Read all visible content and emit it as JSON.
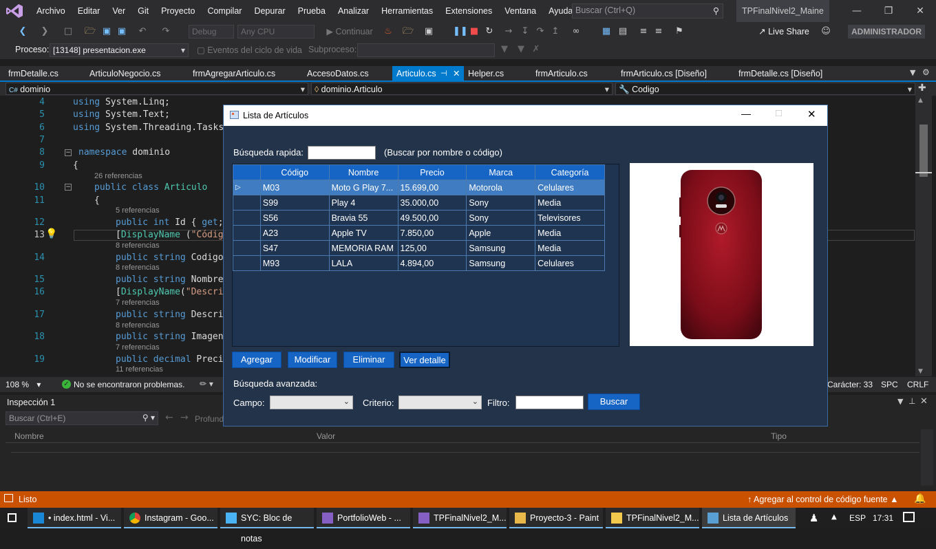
{
  "vs": {
    "menu": [
      "Archivo",
      "Editar",
      "Ver",
      "Git",
      "Proyecto",
      "Compilar",
      "Depurar",
      "Prueba",
      "Analizar",
      "Herramientas",
      "Extensiones",
      "Ventana",
      "Ayuda"
    ],
    "search_placeholder": "Buscar (Ctrl+Q)",
    "solution_title": "TPFinalNivel2_Maine",
    "toolbar": {
      "config": "Debug",
      "platform": "Any CPU",
      "continue": "Continuar",
      "live_share": "Live Share",
      "admin": "ADMINISTRADOR"
    },
    "toolbar2": {
      "process_label": "Proceso:",
      "process_value": "[13148] presentacion.exe",
      "lifecycle": "Eventos del ciclo de vida",
      "subprocess": "Subproceso:"
    },
    "tabs": [
      "frmDetalle.cs",
      "ArticuloNegocio.cs",
      "frmAgregarArticulo.cs",
      "AccesoDatos.cs",
      "Articulo.cs",
      "Helper.cs",
      "frmArticulo.cs",
      "frmArticulo.cs [Diseño]",
      "frmDetalle.cs [Diseño]"
    ],
    "nav": {
      "project": "dominio",
      "class": "dominio.Articulo",
      "member": "Codigo"
    },
    "code_lines": [
      {
        "n": "4",
        "text": "using System.Linq;"
      },
      {
        "n": "5",
        "text": "using System.Text;"
      },
      {
        "n": "6",
        "text": "using System.Threading.Tasks"
      },
      {
        "n": "7",
        "text": ""
      },
      {
        "n": "8",
        "text": "namespace dominio"
      },
      {
        "n": "9",
        "text": "{"
      },
      {
        "n": "10",
        "text": "public class Articulo",
        "ref": "26 referencias"
      },
      {
        "n": "11",
        "text": "{"
      },
      {
        "n": "12",
        "text": "public int Id { get;",
        "ref": "5 referencias"
      },
      {
        "n": "13",
        "text": "[DisplayName (\"Códig"
      },
      {
        "n": "14",
        "text": "public string Codigo",
        "ref": "8 referencias"
      },
      {
        "n": "15",
        "text": "public string Nombre",
        "ref": "8 referencias"
      },
      {
        "n": "16",
        "text": "[DisplayName(\"Descri"
      },
      {
        "n": "17",
        "text": "public string Descri",
        "ref": "7 referencias"
      },
      {
        "n": "18",
        "text": "public string Imagen",
        "ref": "8 referencias"
      },
      {
        "n": "19",
        "text": "public decimal Preci",
        "ref": "7 referencias"
      },
      {
        "n": "",
        "text": "",
        "ref": "11 referencias"
      }
    ],
    "editor_status": {
      "zoom": "108 %",
      "problems": "No se encontraron problemas.",
      "char": "Carácter: 33",
      "spc": "SPC",
      "crlf": "CRLF"
    },
    "inspect": {
      "title": "Inspección 1",
      "search": "Buscar (Ctrl+E)",
      "depth": "Profund",
      "col_name": "Nombre",
      "col_value": "Valor",
      "col_type": "Tipo"
    },
    "status": {
      "ready": "Listo",
      "source_control": "Agregar al control de código fuente"
    }
  },
  "form": {
    "title": "Lista de Artículos",
    "quick_search_label": "Búsqueda rapida:",
    "quick_search_hint": "(Buscar por nombre o código)",
    "columns": [
      "Código",
      "Nombre",
      "Precio",
      "Marca",
      "Categoría"
    ],
    "rows": [
      [
        "M03",
        "Moto G Play 7...",
        "15.699,00",
        "Motorola",
        "Celulares"
      ],
      [
        "S99",
        "Play 4",
        "35.000,00",
        "Sony",
        "Media"
      ],
      [
        "S56",
        "Bravia 55",
        "49.500,00",
        "Sony",
        "Televisores"
      ],
      [
        "A23",
        "Apple TV",
        "7.850,00",
        "Apple",
        "Media"
      ],
      [
        "S47",
        "MEMORIA RAM",
        "125,00",
        "Samsung",
        "Media"
      ],
      [
        "M93",
        "LALA",
        "4.894,00",
        "Samsung",
        "Celulares"
      ]
    ],
    "buttons": {
      "add": "Agregar",
      "modify": "Modificar",
      "delete": "Eliminar",
      "detail": "Ver detalle"
    },
    "advanced_label": "Búsqueda avanzada:",
    "field_label": "Campo:",
    "criteria_label": "Criterio:",
    "filter_label": "Filtro:",
    "search_button": "Buscar"
  },
  "taskbar": {
    "items": [
      "• index.html - Vi...",
      "Instagram - Goo...",
      "SYC: Bloc de notas",
      "PortfolioWeb - ...",
      "TPFinalNivel2_M...",
      "Proyecto-3 - Paint",
      "TPFinalNivel2_M...",
      "Lista de Artículos"
    ],
    "lang": "ESP",
    "time": "17:31"
  }
}
